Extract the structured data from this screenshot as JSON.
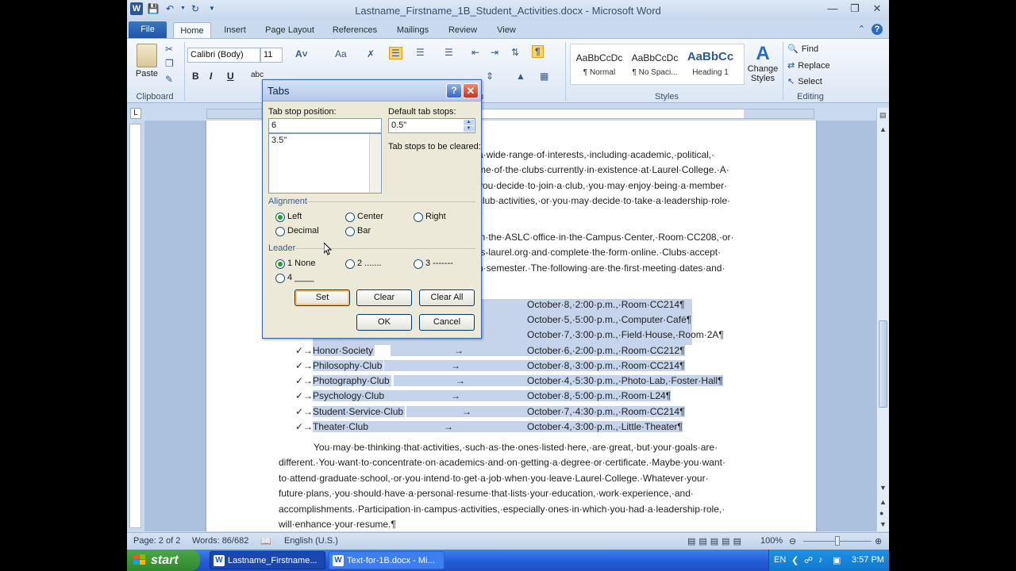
{
  "window": {
    "title": "Lastname_Firstname_1B_Student_Activities.docx - Microsoft Word"
  },
  "ribbon": {
    "file_tab": "File",
    "tabs": [
      "Home",
      "Insert",
      "Page Layout",
      "References",
      "Mailings",
      "Review",
      "View"
    ],
    "clipboard": {
      "paste": "Paste",
      "label": "Clipboard"
    },
    "font": {
      "name": "Calibri (Body)",
      "size": "11"
    },
    "paragraph_label": "h",
    "styles": {
      "items": [
        {
          "sample": "AaBbCcDc",
          "name": "¶ Normal"
        },
        {
          "sample": "AaBbCcDc",
          "name": "¶ No Spaci..."
        },
        {
          "sample": "AaBbCc",
          "name": "Heading 1"
        }
      ],
      "change_styles": "Change Styles",
      "label": "Styles"
    },
    "editing": {
      "find": "Find",
      "replace": "Replace",
      "select": "Select",
      "label": "Editing"
    }
  },
  "document": {
    "lines_top": [
      "a·wide·range·of·interests,·including·academic,·political,·",
      "me·of·the·clubs·currently·in·existence·at·Laurel·College.·A·",
      "you·decide·to·join·a·club,·you·may·enjoy·being·a·member·",
      "club·activities,·or·you·may·decide·to·take·a·leadership·role·"
    ],
    "lines_mid": [
      "in·the·ASLC·office·in·the·Campus·Center,·Room·CC208,·or·",
      "ts-laurel.org·and·complete·the·form·online.·Clubs·accept·",
      "h·semester.·The·following·are·the·first·meeting·dates·and·"
    ],
    "partial_rows": [
      "October·8,·2:00·p.m.,·Room·CC214¶",
      "October·5,·5:00·p.m.,·Computer·Café¶",
      "October·7,·3:00·p.m.,·Field·House,·Room·2A¶"
    ],
    "clubs": [
      {
        "name": "Honor·Society",
        "info": "October·6,·2:00·p.m.,·Room·CC212¶"
      },
      {
        "name": "Philosophy·Club",
        "info": "October·8,·3:00·p.m.,·Room·CC214¶"
      },
      {
        "name": "Photography·Club",
        "info": "October·4,·5:30·p.m.,·Photo·Lab,·Foster·Hall¶"
      },
      {
        "name": "Psychology·Club",
        "info": "October·8,·5:00·p.m.,·Room·L24¶"
      },
      {
        "name": "Student·Service·Club",
        "info": "October·7,·4:30·p.m.,·Room·CC214¶"
      },
      {
        "name": "Theater·Club",
        "info": "October·4,·3:00·p.m.,·Little·Theater¶"
      }
    ],
    "lines_bottom": [
      "You·may·be·thinking·that·activities,·such·as·the·ones·listed·here,·are·great,·but·your·goals·are·",
      "different.·You·want·to·concentrate·on·academics·and·on·getting·a·degree·or·certificate.·Maybe·you·want·",
      "to·attend·graduate·school,·or·you·intend·to·get·a·job·when·you·leave·Laurel·College.·Whatever·your·",
      "future·plans,·you·should·have·a·personal·resume·that·lists·your·education,·work·experience,·and·",
      "accomplishments.·Participation·in·campus·activities,·especially·ones·in·which·you·had·a·leadership·role,·",
      "will·enhance·your·resume.¶"
    ]
  },
  "status": {
    "page": "Page: 2 of 2",
    "words": "Words: 86/682",
    "language": "English (U.S.)",
    "zoom": "100%"
  },
  "taskbar": {
    "start": "start",
    "items": [
      "Lastname_Firstname...",
      "Text-for-1B.docx - Mi..."
    ],
    "lang": "EN",
    "time": "3:57 PM"
  },
  "dialog": {
    "title": "Tabs",
    "tab_stop_label": "Tab stop position:",
    "tab_stop_value": "6",
    "tab_list": [
      "3.5\""
    ],
    "default_label": "Default tab stops:",
    "default_value": "0.5\"",
    "cleared_label": "Tab stops to be cleared:",
    "alignment_label": "Alignment",
    "alignment": [
      "Left",
      "Center",
      "Right",
      "Decimal",
      "Bar"
    ],
    "alignment_selected": "Left",
    "leader_label": "Leader",
    "leader": [
      "1 None",
      "2 .......",
      "3 -------",
      "4 ____"
    ],
    "leader_selected": "1 None",
    "buttons": {
      "set": "Set",
      "clear": "Clear",
      "clear_all": "Clear All",
      "ok": "OK",
      "cancel": "Cancel"
    }
  }
}
